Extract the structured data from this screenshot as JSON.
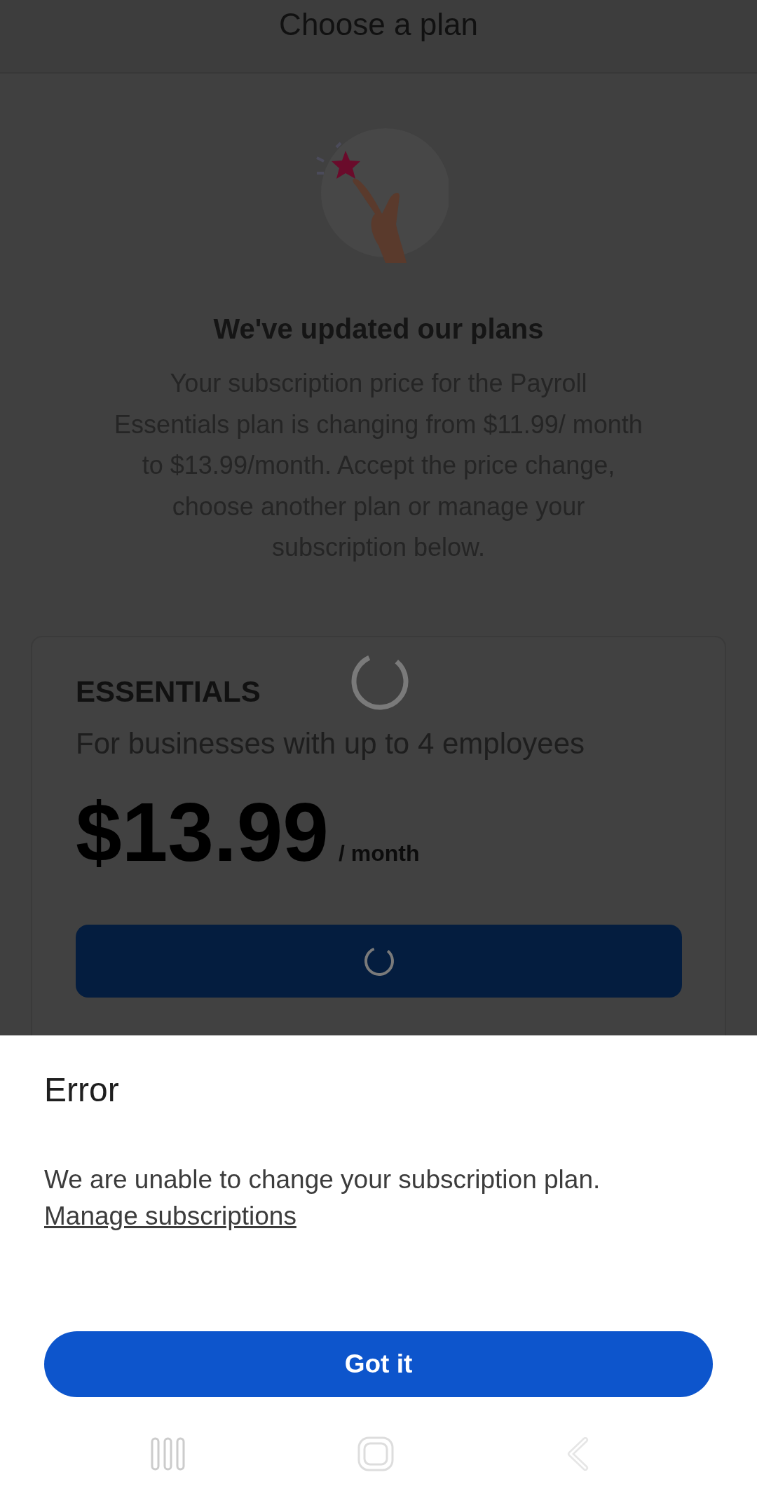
{
  "header": {
    "title": "Choose a plan"
  },
  "intro": {
    "heading": "We've updated our plans",
    "text": "Your subscription price for the Payroll Essentials plan is changing from $11.99/ month to $13.99/month. Accept the price change, choose another plan or manage your subscription below."
  },
  "plan": {
    "name": "ESSENTIALS",
    "description": "For businesses with up to 4 employees",
    "price": "$13.99",
    "period": "/ month",
    "loading": true,
    "button_loading": true
  },
  "dialog": {
    "title": "Error",
    "message": "We are unable to change your subscription plan.",
    "link": "Manage subscriptions",
    "button": "Got it"
  }
}
